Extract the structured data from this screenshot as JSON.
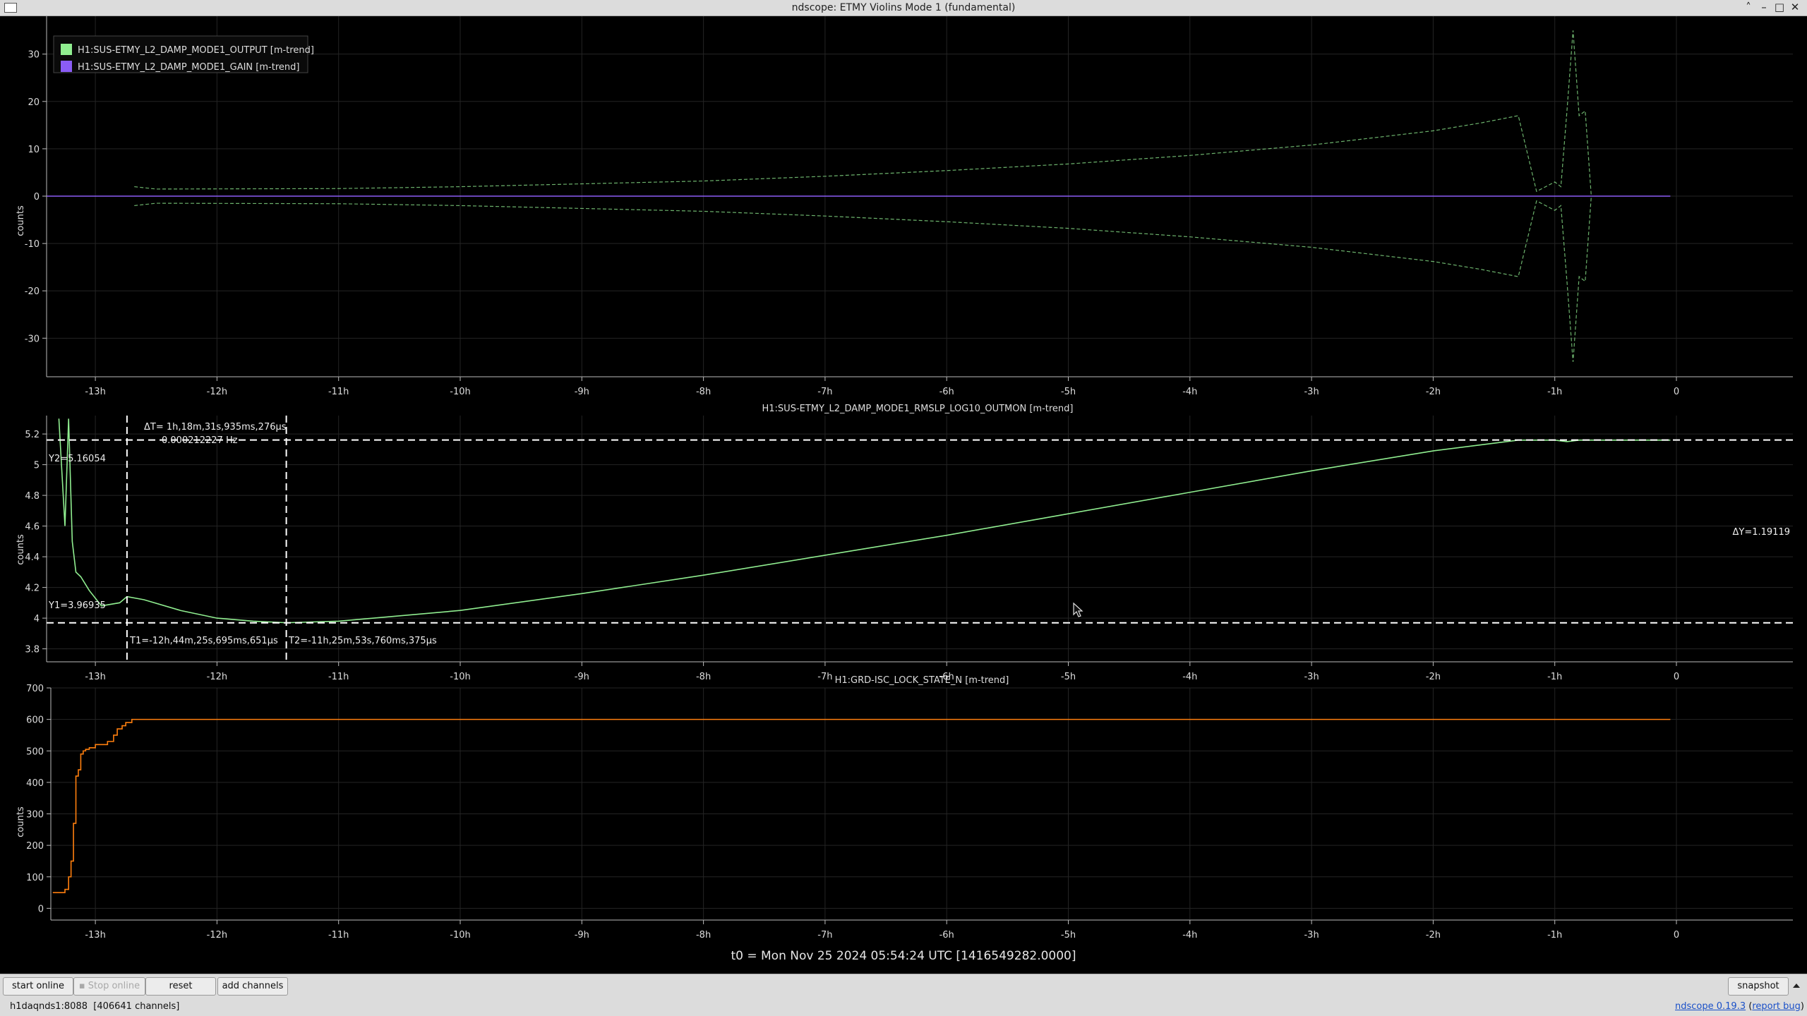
{
  "window": {
    "title": "ndscope: ETMY Violins Mode 1 (fundamental)",
    "controls": [
      "˄",
      "–",
      "□",
      "✕"
    ]
  },
  "plots": [
    {
      "id": "plot1",
      "title": "",
      "ylabel": "counts",
      "yticks": [
        30,
        20,
        10,
        0,
        -10,
        -20,
        -30
      ],
      "ylim": [
        -38,
        38
      ],
      "xticks": [
        "-13h",
        "-12h",
        "-11h",
        "-10h",
        "-9h",
        "-8h",
        "-7h",
        "-6h",
        "-5h",
        "-4h",
        "-3h",
        "-2h",
        "-1h",
        "0"
      ],
      "legend": [
        {
          "label": "H1:SUS-ETMY_L2_DAMP_MODE1_OUTPUT [m-trend]",
          "color": "#90ee90"
        },
        {
          "label": "H1:SUS-ETMY_L2_DAMP_MODE1_GAIN [m-trend]",
          "color": "#8a5cf5"
        }
      ]
    },
    {
      "id": "plot2",
      "title": "H1:SUS-ETMY_L2_DAMP_MODE1_RMSLP_LOG10_OUTMON [m-trend]",
      "ylabel": "counts",
      "yticks": [
        "5.2",
        "5",
        "4.8",
        "4.6",
        "4.4",
        "4.2",
        "4",
        "3.8"
      ],
      "ylim": [
        3.72,
        5.32
      ],
      "xticks": [
        "-13h",
        "-12h",
        "-11h",
        "-10h",
        "-9h",
        "-8h",
        "-7h",
        "-6h",
        "-5h",
        "-4h",
        "-3h",
        "-2h",
        "-1h",
        "0"
      ],
      "cursors": {
        "delta_t_line1": "ΔT=  1h,18m,31s,935ms,276μs",
        "delta_t_line2": "0.000212227 Hz",
        "y2": "Y2=5.16054",
        "y1": "Y1=3.96935",
        "delta_y": "ΔY=1.19119",
        "t1": "T1=-12h,44m,25s,695ms,651μs",
        "t2": "T2=-11h,25m,53s,760ms,375μs"
      }
    },
    {
      "id": "plot3",
      "title": "H1:GRD-ISC_LOCK_STATE_N [m-trend]",
      "ylabel": "counts",
      "yticks": [
        700,
        600,
        500,
        400,
        300,
        200,
        100,
        0
      ],
      "ylim": [
        -35,
        700
      ],
      "xticks": [
        "-13h",
        "-12h",
        "-11h",
        "-10h",
        "-9h",
        "-8h",
        "-7h",
        "-6h",
        "-5h",
        "-4h",
        "-3h",
        "-2h",
        "-1h",
        "0"
      ]
    }
  ],
  "chart_data": [
    {
      "type": "line",
      "xlabel": "",
      "ylabel": "counts",
      "x_unit": "hours",
      "ylim": [
        -38,
        38
      ],
      "grid": true,
      "legend_position": "top-left",
      "series": [
        {
          "name": "H1:SUS-ETMY_L2_DAMP_MODE1_OUTPUT [m-trend]",
          "color": "#90ee90",
          "style": "dashed envelope",
          "x": [
            -12.68,
            -12.5,
            -11,
            -10,
            -9,
            -8,
            -7,
            -6,
            -5,
            -4,
            -3,
            -2,
            -1.6,
            -1.3,
            -1.15,
            -1.0,
            -0.95,
            -0.9,
            -0.85,
            -0.8,
            -0.75,
            -0.7
          ],
          "upper": [
            2,
            1.5,
            1.6,
            2,
            2.6,
            3.2,
            4.2,
            5.4,
            6.8,
            8.6,
            10.8,
            13.8,
            15.5,
            17,
            1,
            3,
            2,
            18,
            35,
            17,
            18,
            0
          ],
          "lower": [
            -2,
            -1.5,
            -1.6,
            -2,
            -2.6,
            -3.2,
            -4.2,
            -5.4,
            -6.8,
            -8.6,
            -10.8,
            -13.8,
            -15.5,
            -17,
            -1,
            -3,
            -2,
            -18,
            -35,
            -17,
            -18,
            0
          ]
        },
        {
          "name": "H1:SUS-ETMY_L2_DAMP_MODE1_GAIN [m-trend]",
          "color": "#8a5cf5",
          "x": [
            -13.4,
            -0.05
          ],
          "y": [
            0,
            0
          ]
        }
      ]
    },
    {
      "type": "line",
      "title": "H1:SUS-ETMY_L2_DAMP_MODE1_RMSLP_LOG10_OUTMON [m-trend]",
      "ylabel": "counts",
      "x_unit": "hours",
      "ylim": [
        3.72,
        5.32
      ],
      "grid": true,
      "series": [
        {
          "name": "H1:SUS-ETMY_L2_DAMP_MODE1_RMSLP_LOG10_OUTMON [m-trend]",
          "color": "#90ee90",
          "x": [
            -13.3,
            -13.25,
            -13.22,
            -13.19,
            -13.16,
            -13.12,
            -13.05,
            -12.95,
            -12.8,
            -12.74,
            -12.6,
            -12.3,
            -12.0,
            -11.7,
            -11.43,
            -11.0,
            -10.0,
            -9.0,
            -8.0,
            -7.0,
            -6.0,
            -5.0,
            -4.0,
            -3.0,
            -2.0,
            -1.3,
            -1.0,
            -0.9,
            -0.8,
            -0.05
          ],
          "y": [
            5.3,
            4.6,
            5.3,
            4.5,
            4.3,
            4.27,
            4.18,
            4.08,
            4.1,
            4.14,
            4.12,
            4.05,
            4.0,
            3.98,
            3.97,
            3.98,
            4.05,
            4.16,
            4.28,
            4.41,
            4.54,
            4.68,
            4.82,
            4.96,
            5.09,
            5.16,
            5.16,
            5.15,
            5.16,
            5.16
          ]
        }
      ],
      "cursors": {
        "T1": -12.74,
        "T2": -11.43,
        "Y1": 3.96935,
        "Y2": 5.16054
      }
    },
    {
      "type": "line",
      "title": "H1:GRD-ISC_LOCK_STATE_N [m-trend]",
      "ylabel": "counts",
      "x_unit": "hours",
      "ylim": [
        -35,
        700
      ],
      "grid": true,
      "series": [
        {
          "name": "H1:GRD-ISC_LOCK_STATE_N [m-trend]",
          "color": "#ff7f0e",
          "style": "step",
          "x": [
            -13.35,
            -13.3,
            -13.25,
            -13.22,
            -13.2,
            -13.18,
            -13.16,
            -13.14,
            -13.12,
            -13.1,
            -13.08,
            -13.05,
            -13.0,
            -12.95,
            -12.9,
            -12.85,
            -12.82,
            -12.78,
            -12.75,
            -12.7,
            -0.05
          ],
          "y": [
            50,
            50,
            60,
            100,
            150,
            270,
            420,
            440,
            490,
            500,
            505,
            510,
            520,
            520,
            530,
            550,
            570,
            580,
            590,
            600,
            600
          ]
        }
      ]
    }
  ],
  "time_label": "t0 = Mon Nov 25 2024 05:54:24 UTC [1416549282.0000]",
  "toolbar": {
    "start_online": "start online",
    "stop_online": "▪ Stop online",
    "reset": "reset",
    "add_channels": "add channels",
    "snapshot": "snapshot",
    "expand_icon": "triangle-up-icon"
  },
  "status": {
    "server": "h1daqnds1:8088",
    "channels": "[406641 channels]",
    "version_link": "ndscope 0.19.3",
    "report_link": "report bug"
  },
  "colors": {
    "output": "#90ee90",
    "gain": "#8a5cf5",
    "lock_state": "#ff7f0e",
    "background": "#000000"
  }
}
